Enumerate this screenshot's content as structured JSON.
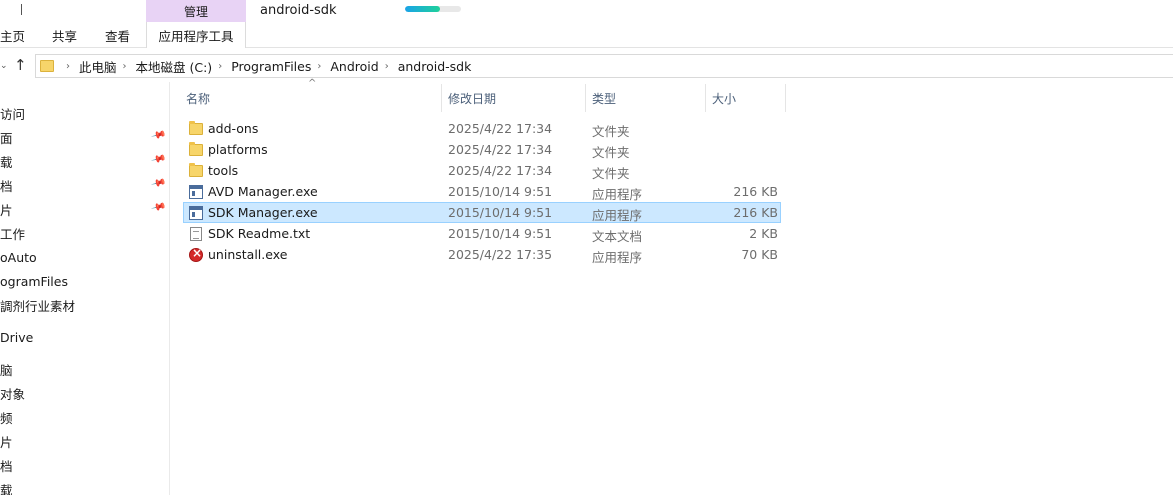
{
  "window": {
    "title": "android-sdk",
    "manage_tab": "管理",
    "load_progress": 0.62
  },
  "ribbon": {
    "tabs": [
      "主页",
      "共享",
      "查看",
      "应用程序工具"
    ]
  },
  "address": {
    "crumbs": [
      "此电脑",
      "本地磁盘 (C:)",
      "ProgramFiles",
      "Android",
      "android-sdk"
    ]
  },
  "nav": {
    "items": [
      {
        "label": "访问",
        "pinned": false
      },
      {
        "label": "面",
        "pinned": true
      },
      {
        "label": "载",
        "pinned": true
      },
      {
        "label": "档",
        "pinned": true
      },
      {
        "label": "片",
        "pinned": true
      },
      {
        "label": "工作",
        "pinned": false
      },
      {
        "label": "oAuto",
        "pinned": false
      },
      {
        "label": "ogramFiles",
        "pinned": false
      },
      {
        "label": "調剂行业素材",
        "pinned": false
      },
      {
        "label": "Drive",
        "pinned": false
      },
      {
        "label": "脑",
        "pinned": false
      },
      {
        "label": "对象",
        "pinned": false
      },
      {
        "label": "频",
        "pinned": false
      },
      {
        "label": "片",
        "pinned": false
      },
      {
        "label": "档",
        "pinned": false
      },
      {
        "label": "载",
        "pinned": false
      }
    ]
  },
  "columns": {
    "name": "名称",
    "date": "修改日期",
    "type": "类型",
    "size": "大小"
  },
  "files": [
    {
      "name": "add-ons",
      "date": "2025/4/22 17:34",
      "type": "文件夹",
      "size": "",
      "icon": "folder-icon"
    },
    {
      "name": "platforms",
      "date": "2025/4/22 17:34",
      "type": "文件夹",
      "size": "",
      "icon": "folder-icon"
    },
    {
      "name": "tools",
      "date": "2025/4/22 17:34",
      "type": "文件夹",
      "size": "",
      "icon": "folder-icon"
    },
    {
      "name": "AVD Manager.exe",
      "date": "2015/10/14 9:51",
      "type": "应用程序",
      "size": "216 KB",
      "icon": "exe-icon"
    },
    {
      "name": "SDK Manager.exe",
      "date": "2015/10/14 9:51",
      "type": "应用程序",
      "size": "216 KB",
      "icon": "exe-icon",
      "selected": true
    },
    {
      "name": "SDK Readme.txt",
      "date": "2015/10/14 9:51",
      "type": "文本文档",
      "size": "2 KB",
      "icon": "txt-icon"
    },
    {
      "name": "uninstall.exe",
      "date": "2025/4/22 17:35",
      "type": "应用程序",
      "size": "70 KB",
      "icon": "uninstall-icon"
    }
  ],
  "colors": {
    "manage_tab_bg": "#e8d3f5",
    "selection_bg": "#cce8ff",
    "selection_border": "#99d1ff"
  }
}
